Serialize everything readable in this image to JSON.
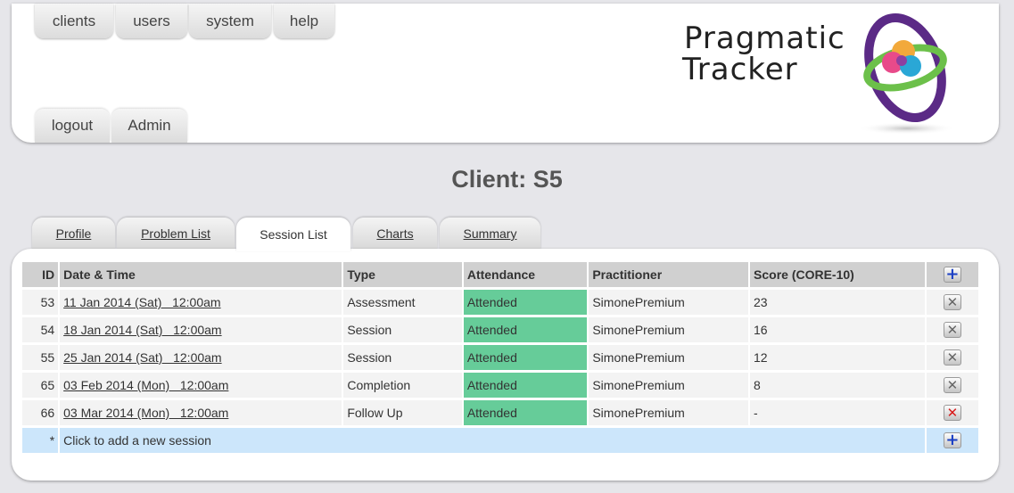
{
  "nav": {
    "top": [
      "clients",
      "users",
      "system",
      "help"
    ],
    "bottom": [
      "logout",
      "Admin"
    ]
  },
  "logo": {
    "line1": "Pragmatic",
    "line2": "Tracker"
  },
  "page": {
    "title": "Client: S5"
  },
  "tabs": [
    {
      "label": "Profile",
      "active": false
    },
    {
      "label": "Problem List",
      "active": false
    },
    {
      "label": "Session List",
      "active": true
    },
    {
      "label": "Charts",
      "active": false
    },
    {
      "label": "Summary",
      "active": false
    }
  ],
  "table": {
    "headers": [
      "ID",
      "Date & Time",
      "Type",
      "Attendance",
      "Practitioner",
      "Score (CORE-10)"
    ],
    "rows": [
      {
        "id": "53",
        "datetime": "11 Jan 2014 (Sat)   12:00am",
        "type": "Assessment",
        "attendance": "Attended",
        "practitioner": "SimonePremium",
        "score": "23"
      },
      {
        "id": "54",
        "datetime": "18 Jan 2014 (Sat)   12:00am",
        "type": "Session",
        "attendance": "Attended",
        "practitioner": "SimonePremium",
        "score": "16"
      },
      {
        "id": "55",
        "datetime": "25 Jan 2014 (Sat)   12:00am",
        "type": "Session",
        "attendance": "Attended",
        "practitioner": "SimonePremium",
        "score": "12"
      },
      {
        "id": "65",
        "datetime": "03 Feb 2014 (Mon)   12:00am",
        "type": "Completion",
        "attendance": "Attended",
        "practitioner": "SimonePremium",
        "score": "8"
      },
      {
        "id": "66",
        "datetime": "03 Mar 2014 (Mon)   12:00am",
        "type": "Follow Up",
        "attendance": "Attended",
        "practitioner": "SimonePremium",
        "score": "-"
      }
    ],
    "add_row": {
      "marker": "*",
      "label": "Click to add a new session"
    }
  },
  "icons": {
    "add": "plus-icon",
    "delete": "delete-x-icon"
  },
  "colors": {
    "attended": "#66cc99",
    "add_row": "#cce6fb",
    "header": "#d0d0d0",
    "add_icon": "#1a3fc4",
    "delete_active": "#d81a1a"
  }
}
